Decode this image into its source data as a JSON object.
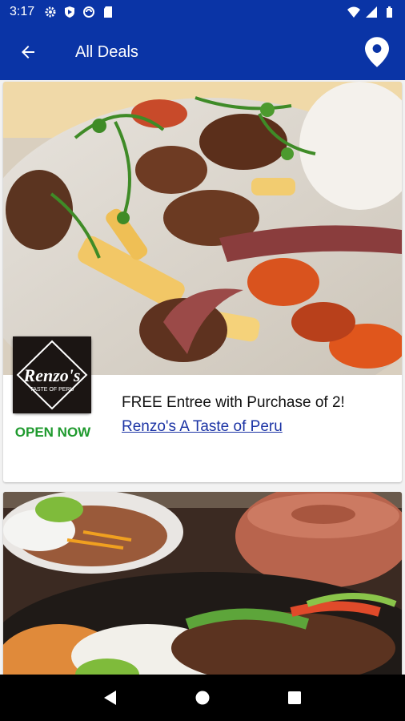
{
  "status_bar": {
    "time": "3:17",
    "icons": [
      "gear-icon",
      "shield-icon",
      "sync-icon",
      "sd-card-icon"
    ],
    "right_icons": [
      "wifi-icon",
      "signal-icon",
      "battery-icon"
    ]
  },
  "app_bar": {
    "title": "All Deals",
    "back_icon": "arrow-left-icon",
    "location_icon": "location-pin-icon"
  },
  "deals": [
    {
      "logo_text": "Renzo's",
      "logo_subtext": "TASTE OF PERU",
      "status": "OPEN NOW",
      "title": "FREE Entree with Purchase of 2!",
      "restaurant": "Renzo's A Taste of Peru"
    }
  ],
  "colors": {
    "primary": "#0a34a6",
    "open_green": "#1f9a2e",
    "link_blue": "#1c34a5"
  },
  "nav_bar": {
    "buttons": [
      "back-triangle-icon",
      "home-circle-icon",
      "recents-square-icon"
    ]
  }
}
